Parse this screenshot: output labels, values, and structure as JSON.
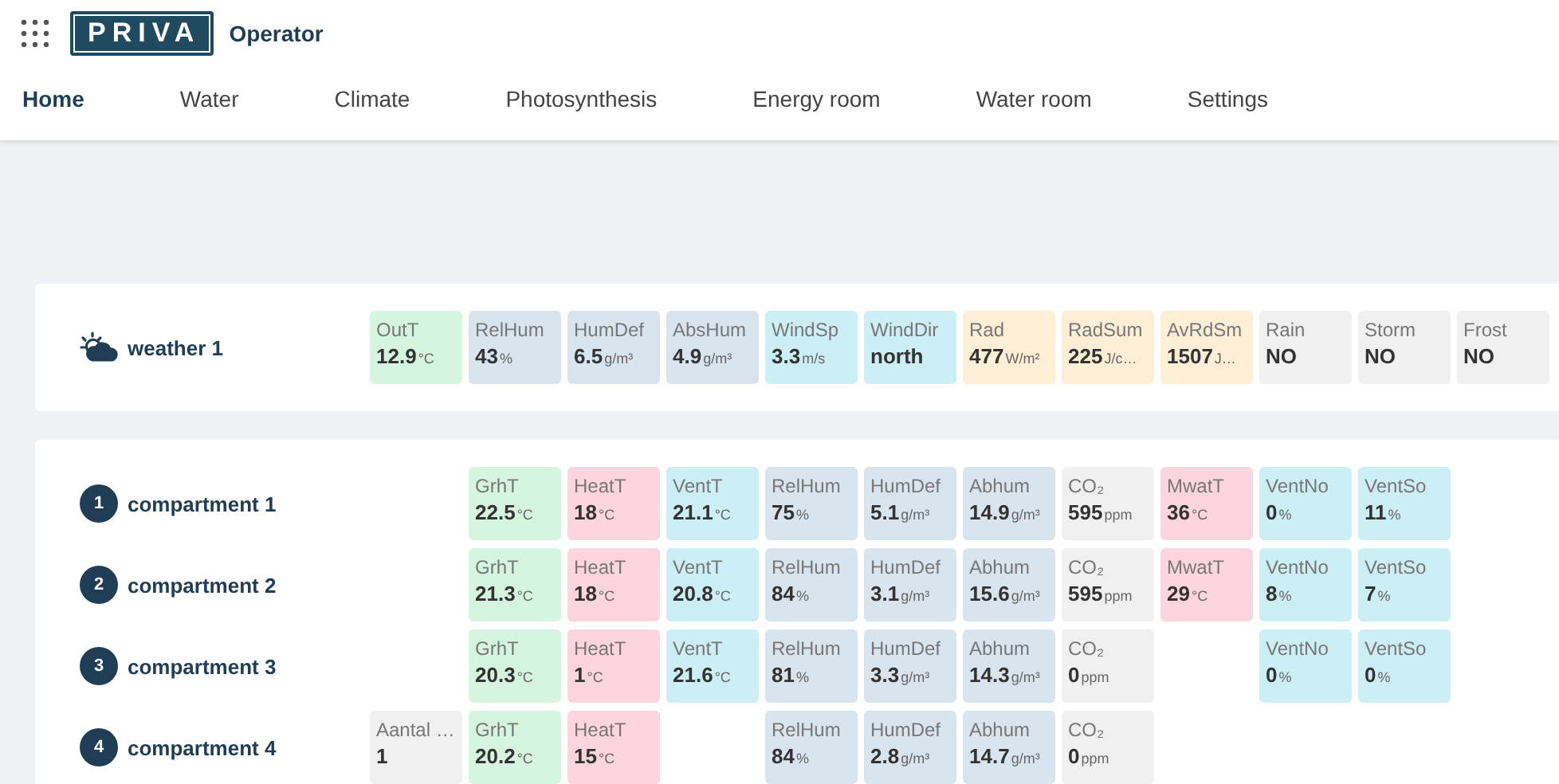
{
  "header": {
    "brand": "PRIVA",
    "app_name": "Operator"
  },
  "nav": [
    {
      "label": "Home",
      "selected": true
    },
    {
      "label": "Water",
      "selected": false
    },
    {
      "label": "Climate",
      "selected": false
    },
    {
      "label": "Photosynthesis",
      "selected": false
    },
    {
      "label": "Energy room",
      "selected": false
    },
    {
      "label": "Water room",
      "selected": false
    },
    {
      "label": "Settings",
      "selected": false
    }
  ],
  "weather": {
    "name": "weather 1",
    "tiles": [
      {
        "label": "OutT",
        "value": "12.9",
        "unit": "°C",
        "color": "#d5f5de"
      },
      {
        "label": "RelHum",
        "value": "43",
        "unit": "%",
        "color": "#d9e5ee"
      },
      {
        "label": "HumDef",
        "value": "6.5",
        "unit": "g/m³",
        "color": "#d9e5ee"
      },
      {
        "label": "AbsHum",
        "value": "4.9",
        "unit": "g/m³",
        "color": "#d9e5ee"
      },
      {
        "label": "WindSp",
        "value": "3.3",
        "unit": "m/s",
        "color": "#cbeff5"
      },
      {
        "label": "WindDir",
        "value": "north",
        "color": "#cbeff5"
      },
      {
        "label": "Rad",
        "value": "477",
        "unit": "W/m²",
        "color": "#fdeed6"
      },
      {
        "label": "RadSum",
        "value": "225",
        "unit": "J/c…",
        "color": "#fdeed6"
      },
      {
        "label": "AvRdSm",
        "value": "1507",
        "unit": "J…",
        "color": "#fdeed6"
      },
      {
        "label": "Rain",
        "value": "NO",
        "color": "#f0f0f0"
      },
      {
        "label": "Storm",
        "value": "NO",
        "color": "#f0f0f0"
      },
      {
        "label": "Frost",
        "value": "NO",
        "color": "#f0f0f0"
      }
    ]
  },
  "compartments": [
    {
      "number": "1",
      "name": "compartment 1",
      "tiles": [
        {
          "kind": "gap"
        },
        {
          "kind": "tile",
          "label": "GrhT",
          "value": "22.5",
          "unit": "°C",
          "color": "#d5f5de"
        },
        {
          "kind": "tile",
          "label": "HeatT",
          "value": "18",
          "unit": "°C",
          "color": "#fdd5de"
        },
        {
          "kind": "tile",
          "label": "VentT",
          "value": "21.1",
          "unit": "°C",
          "color": "#cbeff5"
        },
        {
          "kind": "tile",
          "label": "RelHum",
          "value": "75",
          "unit": "%",
          "color": "#d9e5ee"
        },
        {
          "kind": "tile",
          "label": "HumDef",
          "value": "5.1",
          "unit": "g/m³",
          "color": "#d9e5ee"
        },
        {
          "kind": "tile",
          "label": "Abhum",
          "value": "14.9",
          "unit": "g/m³",
          "color": "#d9e5ee"
        },
        {
          "kind": "tile",
          "label": "CO₂",
          "value": "595",
          "unit": "ppm",
          "color": "#f0f0f0"
        },
        {
          "kind": "tile",
          "label": "MwatT",
          "value": "36",
          "unit": "°C",
          "color": "#fdd5de"
        },
        {
          "kind": "tile",
          "label": "VentNo",
          "value": "0",
          "unit": "%",
          "color": "#cbeff5"
        },
        {
          "kind": "tile",
          "label": "VentSo",
          "value": "11",
          "unit": "%",
          "color": "#cbeff5"
        }
      ]
    },
    {
      "number": "2",
      "name": "compartment 2",
      "tiles": [
        {
          "kind": "gap"
        },
        {
          "kind": "tile",
          "label": "GrhT",
          "value": "21.3",
          "unit": "°C",
          "color": "#d5f5de"
        },
        {
          "kind": "tile",
          "label": "HeatT",
          "value": "18",
          "unit": "°C",
          "color": "#fdd5de"
        },
        {
          "kind": "tile",
          "label": "VentT",
          "value": "20.8",
          "unit": "°C",
          "color": "#cbeff5"
        },
        {
          "kind": "tile",
          "label": "RelHum",
          "value": "84",
          "unit": "%",
          "color": "#d9e5ee"
        },
        {
          "kind": "tile",
          "label": "HumDef",
          "value": "3.1",
          "unit": "g/m³",
          "color": "#d9e5ee"
        },
        {
          "kind": "tile",
          "label": "Abhum",
          "value": "15.6",
          "unit": "g/m³",
          "color": "#d9e5ee"
        },
        {
          "kind": "tile",
          "label": "CO₂",
          "value": "595",
          "unit": "ppm",
          "color": "#f0f0f0"
        },
        {
          "kind": "tile",
          "label": "MwatT",
          "value": "29",
          "unit": "°C",
          "color": "#fdd5de"
        },
        {
          "kind": "tile",
          "label": "VentNo",
          "value": "8",
          "unit": "%",
          "color": "#cbeff5"
        },
        {
          "kind": "tile",
          "label": "VentSo",
          "value": "7",
          "unit": "%",
          "color": "#cbeff5"
        }
      ]
    },
    {
      "number": "3",
      "name": "compartment 3",
      "tiles": [
        {
          "kind": "gap"
        },
        {
          "kind": "tile",
          "label": "GrhT",
          "value": "20.3",
          "unit": "°C",
          "color": "#d5f5de"
        },
        {
          "kind": "tile",
          "label": "HeatT",
          "value": "1",
          "unit": "°C",
          "color": "#fdd5de"
        },
        {
          "kind": "tile",
          "label": "VentT",
          "value": "21.6",
          "unit": "°C",
          "color": "#cbeff5"
        },
        {
          "kind": "tile",
          "label": "RelHum",
          "value": "81",
          "unit": "%",
          "color": "#d9e5ee"
        },
        {
          "kind": "tile",
          "label": "HumDef",
          "value": "3.3",
          "unit": "g/m³",
          "color": "#d9e5ee"
        },
        {
          "kind": "tile",
          "label": "Abhum",
          "value": "14.3",
          "unit": "g/m³",
          "color": "#d9e5ee"
        },
        {
          "kind": "tile",
          "label": "CO₂",
          "value": "0",
          "unit": "ppm",
          "color": "#f0f0f0"
        },
        {
          "kind": "gap"
        },
        {
          "kind": "tile",
          "label": "VentNo",
          "value": "0",
          "unit": "%",
          "color": "#cbeff5"
        },
        {
          "kind": "tile",
          "label": "VentSo",
          "value": "0",
          "unit": "%",
          "color": "#cbeff5"
        }
      ]
    },
    {
      "number": "4",
      "name": "compartment 4",
      "tiles": [
        {
          "kind": "tile",
          "label": "Aantal …",
          "value": "1",
          "color": "#f0f0f0"
        },
        {
          "kind": "tile",
          "label": "GrhT",
          "value": "20.2",
          "unit": "°C",
          "color": "#d5f5de"
        },
        {
          "kind": "tile",
          "label": "HeatT",
          "value": "15",
          "unit": "°C",
          "color": "#fdd5de"
        },
        {
          "kind": "gap"
        },
        {
          "kind": "tile",
          "label": "RelHum",
          "value": "84",
          "unit": "%",
          "color": "#d9e5ee"
        },
        {
          "kind": "tile",
          "label": "HumDef",
          "value": "2.8",
          "unit": "g/m³",
          "color": "#d9e5ee"
        },
        {
          "kind": "tile",
          "label": "Abhum",
          "value": "14.7",
          "unit": "g/m³",
          "color": "#d9e5ee"
        },
        {
          "kind": "tile",
          "label": "CO₂",
          "value": "0",
          "unit": "ppm",
          "color": "#f0f0f0"
        }
      ]
    }
  ]
}
